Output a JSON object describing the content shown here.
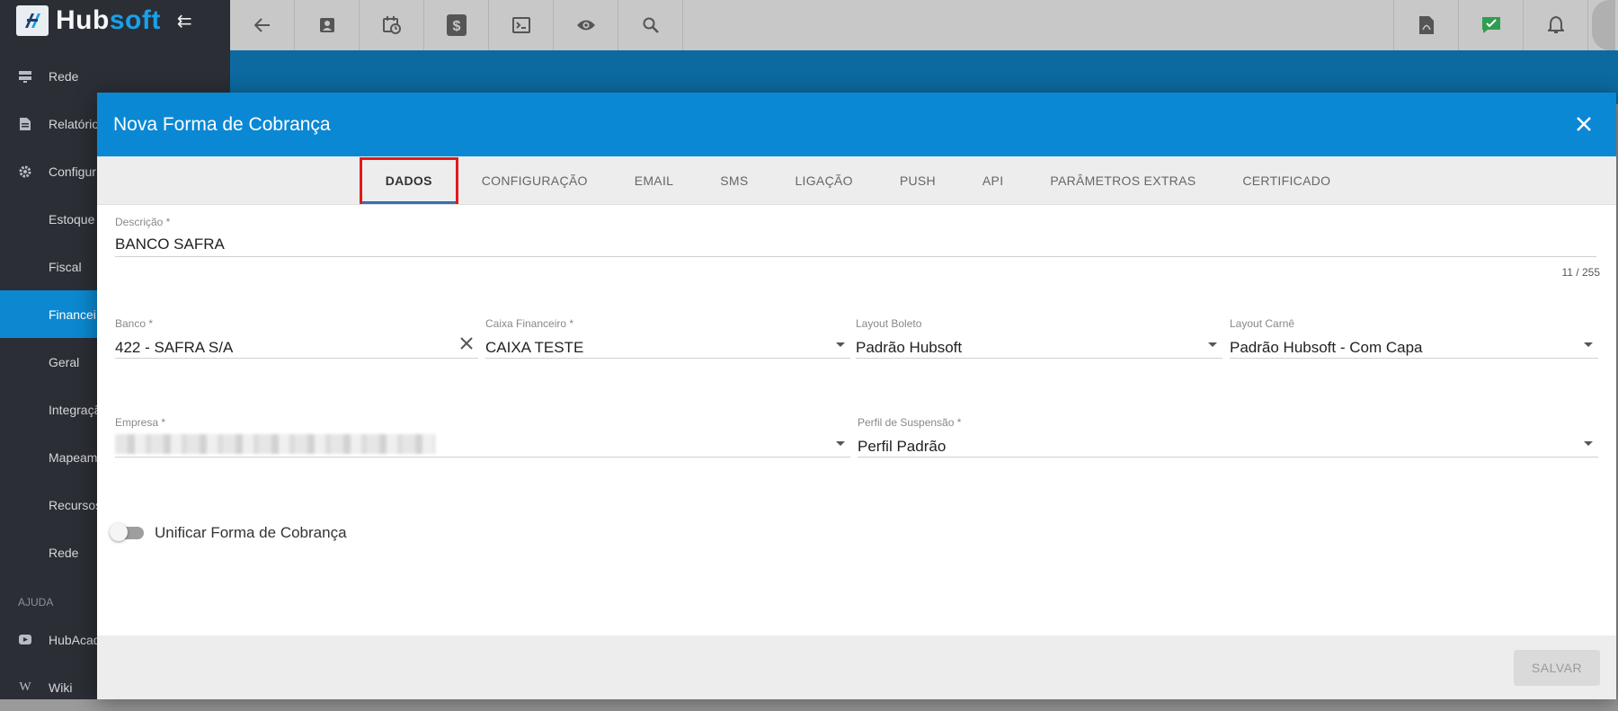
{
  "app": {
    "logo_prefix": "Hub",
    "logo_suffix": "soft"
  },
  "sidebar": {
    "items": [
      {
        "label": "Rede",
        "icon": "server-icon"
      },
      {
        "label": "Relatório",
        "icon": "document-icon"
      },
      {
        "label": "Configur",
        "icon": "gear-icon"
      },
      {
        "label": "Estoque"
      },
      {
        "label": "Fiscal"
      },
      {
        "label": "Financei"
      },
      {
        "label": "Geral"
      },
      {
        "label": "Integraçã"
      },
      {
        "label": "Mapeam"
      },
      {
        "label": "Recursos"
      },
      {
        "label": "Rede"
      }
    ],
    "section_label": "AJUDA",
    "help_items": [
      {
        "label": "HubAcad",
        "icon": "youtube-icon"
      },
      {
        "label": "Wiki",
        "icon": "wikipedia-icon"
      }
    ]
  },
  "topbar": {
    "buttons": [
      "back-arrow-icon",
      "contact-card-icon",
      "calendar-clock-icon",
      "dollar-icon",
      "terminal-icon",
      "eye-icon",
      "search-icon"
    ],
    "right_buttons": [
      "pdf-icon",
      "chat-check-icon",
      "bell-icon"
    ]
  },
  "modal": {
    "title": "Nova Forma de Cobrança",
    "tabs": [
      "DADOS",
      "CONFIGURAÇÃO",
      "EMAIL",
      "SMS",
      "LIGAÇÃO",
      "PUSH",
      "API",
      "PARÂMETROS EXTRAS",
      "CERTIFICADO"
    ],
    "active_tab": "DADOS",
    "fields": {
      "descricao": {
        "label": "Descrição *",
        "value": "BANCO SAFRA",
        "counter": "11 / 255"
      },
      "banco": {
        "label": "Banco *",
        "value": "422 - SAFRA S/A"
      },
      "caixa": {
        "label": "Caixa Financeiro *",
        "value": "CAIXA TESTE"
      },
      "layout_boleto": {
        "label": "Layout Boleto",
        "value": "Padrão Hubsoft"
      },
      "layout_carne": {
        "label": "Layout Carnê",
        "value": "Padrão Hubsoft - Com Capa"
      },
      "empresa": {
        "label": "Empresa *",
        "value": ""
      },
      "perfil": {
        "label": "Perfil de Suspensão *",
        "value": "Perfil Padrão"
      }
    },
    "toggle_label": "Unificar Forma de Cobrança",
    "toggle_on": false,
    "save_label": "SALVAR"
  },
  "colors": {
    "brand": "#0b88d4",
    "sidebar": "#2b2e35",
    "highlight": "#e01b1b"
  }
}
